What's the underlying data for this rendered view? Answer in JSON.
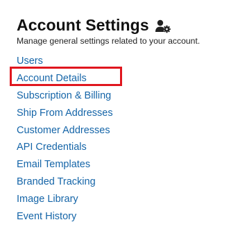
{
  "header": {
    "title": "Account Settings",
    "icon": "user-gear-icon",
    "subtitle": "Manage general settings related to your account."
  },
  "nav": {
    "items": [
      {
        "label": "Users"
      },
      {
        "label": "Account Details",
        "highlighted": true
      },
      {
        "label": "Subscription & Billing"
      },
      {
        "label": "Ship From Addresses"
      },
      {
        "label": "Customer Addresses"
      },
      {
        "label": "API Credentials"
      },
      {
        "label": "Email Templates"
      },
      {
        "label": "Branded Tracking"
      },
      {
        "label": "Image Library"
      },
      {
        "label": "Event History"
      }
    ]
  },
  "colors": {
    "link": "#1565a8",
    "title": "#111111",
    "highlight": "#e0161e"
  }
}
